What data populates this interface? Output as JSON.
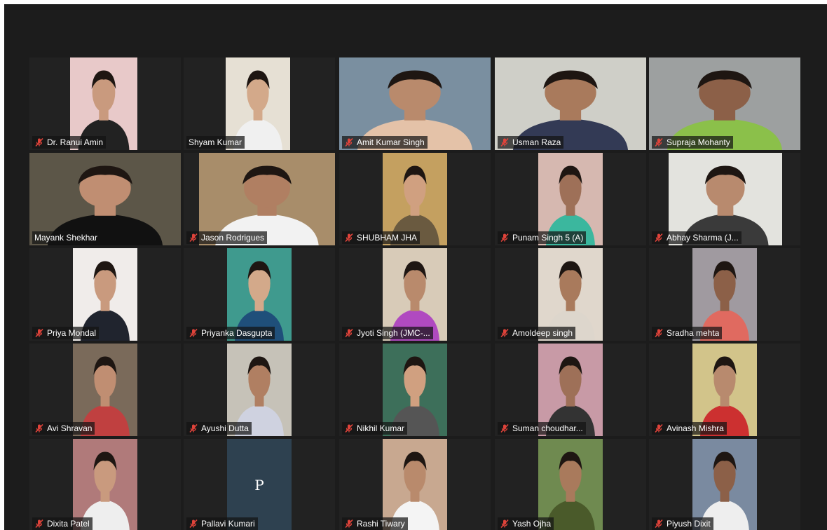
{
  "meeting": {
    "view": "gallery",
    "accent_color": "#c9d94a",
    "muted_icon_color": "#e0433a",
    "participants": [
      {
        "name": "Dr. Ranui Amin",
        "muted": true,
        "video": true,
        "active_speaker": false
      },
      {
        "name": "Shyam Kumar",
        "muted": false,
        "video": true,
        "active_speaker": false
      },
      {
        "name": "Amit Kumar Singh",
        "muted": true,
        "video": true,
        "active_speaker": false
      },
      {
        "name": "Usman Raza",
        "muted": true,
        "video": true,
        "active_speaker": false
      },
      {
        "name": "Supraja Mohanty",
        "muted": true,
        "video": true,
        "active_speaker": false
      },
      {
        "name": "Mayank Shekhar",
        "muted": false,
        "video": true,
        "active_speaker": true
      },
      {
        "name": "Jason Rodrigues",
        "muted": true,
        "video": true,
        "active_speaker": false
      },
      {
        "name": "SHUBHAM JHA",
        "muted": true,
        "video": true,
        "active_speaker": false
      },
      {
        "name": "Punam Singh 5 (A)",
        "muted": true,
        "video": true,
        "active_speaker": false
      },
      {
        "name": "Abhay Sharma (J...",
        "muted": true,
        "video": true,
        "active_speaker": false
      },
      {
        "name": "Priya Mondal",
        "muted": true,
        "video": true,
        "active_speaker": false
      },
      {
        "name": "Priyanka Dasgupta",
        "muted": true,
        "video": true,
        "active_speaker": false
      },
      {
        "name": "Jyoti Singh (JMC-...",
        "muted": true,
        "video": true,
        "active_speaker": false
      },
      {
        "name": "Amoldeep singh",
        "muted": true,
        "video": true,
        "active_speaker": false
      },
      {
        "name": "Sradha mehta",
        "muted": true,
        "video": true,
        "active_speaker": false
      },
      {
        "name": "Avi Shravan",
        "muted": true,
        "video": true,
        "active_speaker": false
      },
      {
        "name": "Ayushi Dutta",
        "muted": true,
        "video": true,
        "active_speaker": false
      },
      {
        "name": "Nikhil Kumar",
        "muted": true,
        "video": true,
        "active_speaker": false
      },
      {
        "name": "Suman choudhar...",
        "muted": true,
        "video": true,
        "active_speaker": false
      },
      {
        "name": "Avinash Mishra",
        "muted": true,
        "video": true,
        "active_speaker": false
      },
      {
        "name": "Dixita Patel",
        "muted": true,
        "video": true,
        "active_speaker": false
      },
      {
        "name": "Pallavi Kumari",
        "muted": true,
        "video": false,
        "initial": "P",
        "active_speaker": false
      },
      {
        "name": "Rashi Tiwary",
        "muted": true,
        "video": true,
        "active_speaker": false
      },
      {
        "name": "Yash Ojha",
        "muted": true,
        "video": true,
        "active_speaker": false
      },
      {
        "name": "Piyush Dixit",
        "muted": true,
        "video": true,
        "active_speaker": false
      }
    ]
  }
}
